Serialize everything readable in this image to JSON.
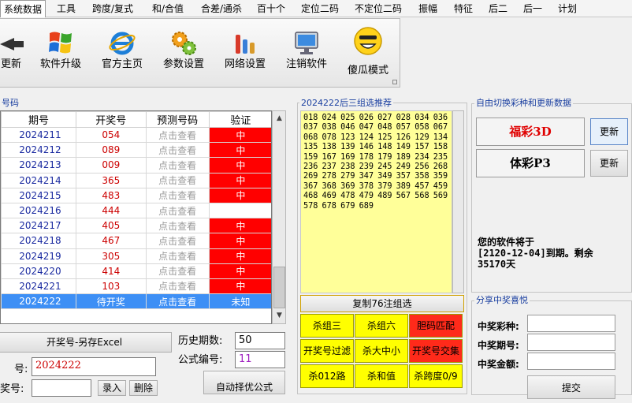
{
  "menu": [
    "系统数据",
    "工具",
    "跨度/复式",
    "和/合值",
    "合差/通杀",
    "百十个",
    "定位二码",
    "不定位二码",
    "振幅",
    "特征",
    "后二",
    "后一",
    "计划"
  ],
  "toolbar": [
    {
      "label": "更新",
      "icon": "update-icon"
    },
    {
      "label": "软件升级",
      "icon": "windows-logo-icon"
    },
    {
      "label": "官方主页",
      "icon": "ie-icon"
    },
    {
      "label": "参数设置",
      "icon": "gears-icon"
    },
    {
      "label": "网络设置",
      "icon": "bar-chart-icon"
    },
    {
      "label": "注销软件",
      "icon": "monitor-icon"
    },
    {
      "label": "傻瓜模式",
      "icon": "smiley-icon"
    }
  ],
  "history": {
    "title": "号码",
    "headers": [
      "期号",
      "开奖号",
      "预测号码",
      "验证"
    ],
    "rows": [
      {
        "period": "2024211",
        "draw": "054",
        "pred": "点击查看",
        "verify": "中"
      },
      {
        "period": "2024212",
        "draw": "089",
        "pred": "点击查看",
        "verify": "中"
      },
      {
        "period": "2024213",
        "draw": "009",
        "pred": "点击查看",
        "verify": "中"
      },
      {
        "period": "2024214",
        "draw": "365",
        "pred": "点击查看",
        "verify": "中"
      },
      {
        "period": "2024215",
        "draw": "483",
        "pred": "点击查看",
        "verify": "中"
      },
      {
        "period": "2024216",
        "draw": "444",
        "pred": "点击查看",
        "verify": ""
      },
      {
        "period": "2024217",
        "draw": "405",
        "pred": "点击查看",
        "verify": "中"
      },
      {
        "period": "2024218",
        "draw": "467",
        "pred": "点击查看",
        "verify": "中"
      },
      {
        "period": "2024219",
        "draw": "305",
        "pred": "点击查看",
        "verify": "中"
      },
      {
        "period": "2024220",
        "draw": "414",
        "pred": "点击查看",
        "verify": "中"
      },
      {
        "period": "2024221",
        "draw": "103",
        "pred": "点击查看",
        "verify": "中"
      },
      {
        "period": "2024222",
        "draw": "待开奖",
        "pred": "点击查看",
        "verify": "未知",
        "current": true
      }
    ]
  },
  "bottom": {
    "export_label": "开奖号-另存Excel",
    "history_count_label": "历史期数:",
    "history_count_value": "50",
    "formula_label": "公式编号:",
    "formula_value": "11",
    "issue_label": "号:",
    "issue_value": "2024222",
    "draw_label": "奖号:",
    "enter_label": "录入",
    "delete_label": "删除",
    "auto_label": "自动择优公式"
  },
  "recommend": {
    "title": "2024222后三组选推荐",
    "numbers": "018 024 025 026 027 028 034 036 037 038 046 047 048 057 058 067 068 078 123 124 125 126 129 134 135 138 139 146 148 149 157 158 159 167 169 178 179 189 234 235 236 237 238 239 245 249 256 268 269 278 279 347 349 357 358 359 367 368 369 378 379 389 457 459 468 469 478 479 489 567 568 569 578 678 679 689",
    "copy_label": "复制76注组选",
    "kill_buttons": [
      {
        "label": "杀组三",
        "red": false
      },
      {
        "label": "杀组六",
        "red": false
      },
      {
        "label": "胆码匹配",
        "red": true
      },
      {
        "label": "开奖号过滤",
        "red": false
      },
      {
        "label": "杀大中小",
        "red": false
      },
      {
        "label": "开奖号交集",
        "red": true
      },
      {
        "label": "杀012路",
        "red": false
      },
      {
        "label": "杀和值",
        "red": false
      },
      {
        "label": "杀跨度0/9",
        "red": false
      }
    ]
  },
  "switch": {
    "title": "自由切换彩种和更新数据",
    "lottery1": "福彩3D",
    "lottery2": "体彩P3",
    "update1": "更新",
    "update2": "更新",
    "notice": "您的软件将于\n[2120-12-04]到期。剩余\n35170天"
  },
  "share": {
    "title": "分享中奖喜悦",
    "fields": [
      "中奖彩种:",
      "中奖期号:",
      "中奖金额:"
    ],
    "submit_label": "提交"
  },
  "colors": {
    "hit": "#ff0000",
    "current_row": "#3d8ff5",
    "recommend_bg": "#ffff99",
    "kill_bg": "#ffff00",
    "kill_red": "#ff2a1a"
  }
}
